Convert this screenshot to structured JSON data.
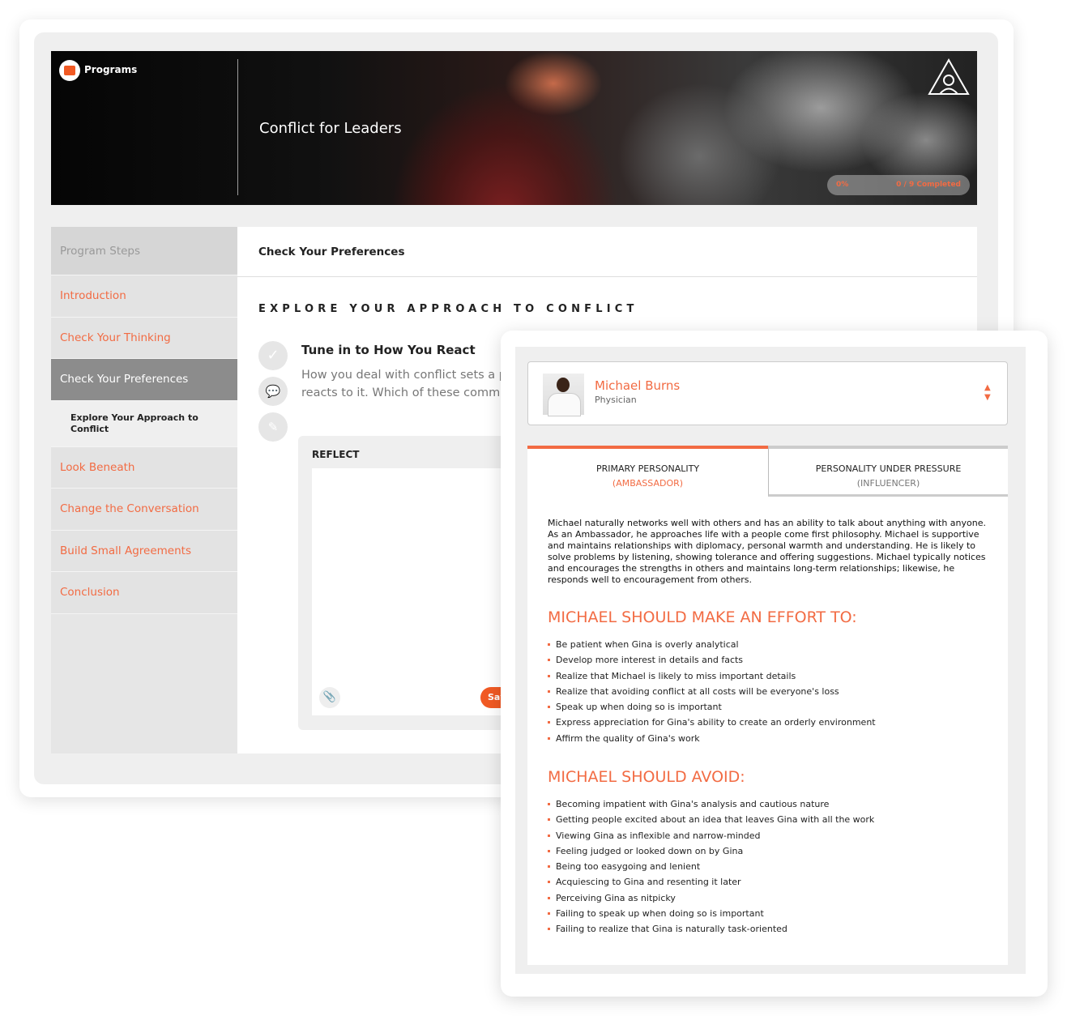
{
  "header": {
    "brand": "Programs",
    "title": "Conflict for Leaders",
    "progress_percent": "0%",
    "progress_count": "0 / 9 Completed",
    "accent": "#f26b43"
  },
  "sidebar": {
    "heading": "Program Steps",
    "items": [
      {
        "label": "Introduction"
      },
      {
        "label": "Check Your Thinking"
      },
      {
        "label": "Check Your Preferences",
        "active": true
      },
      {
        "label": "Explore Your Approach to Conflict",
        "sub": true
      },
      {
        "label": "Look Beneath"
      },
      {
        "label": "Change the Conversation"
      },
      {
        "label": "Build Small Agreements"
      },
      {
        "label": "Conclusion"
      }
    ]
  },
  "main": {
    "breadcrumb": "Check Your Preferences",
    "section_title": "EXPLORE YOUR APPROACH TO CONFLICT",
    "step_title": "Tune in to How You React",
    "desc_line1": "How you deal with conflict sets a p",
    "desc_line2": "reacts to it. Which of these commo",
    "reflect_label": "REFLECT",
    "save_label": "Save"
  },
  "profile": {
    "name": "Michael Burns",
    "role": "Physician",
    "tabs": [
      {
        "label": "PRIMARY PERSONALITY",
        "sub": "(AMBASSADOR)",
        "active": true
      },
      {
        "label": "PERSONALITY UNDER PRESSURE",
        "sub": "(INFLUENCER)"
      }
    ],
    "summary": "Michael naturally networks well with others and has an ability to talk about anything with anyone. As an Ambassador, he approaches life with a people come first philosophy. Michael is supportive and maintains relationships with diplomacy, personal warmth and understanding. He is likely to solve problems by listening, showing tolerance and offering suggestions. Michael typically notices and encourages the strengths in others and maintains long-term relationships; likewise, he responds well to encouragement from others.",
    "effort_heading": "MICHAEL SHOULD MAKE AN EFFORT TO:",
    "effort": [
      "Be patient when Gina is overly analytical",
      "Develop more interest in details and facts",
      "Realize that Michael is likely to miss important details",
      "Realize that avoiding conflict at all costs will be everyone's loss",
      "Speak up when doing so is important",
      "Express appreciation for Gina's ability to create an orderly environment",
      "Affirm the quality of Gina's work"
    ],
    "avoid_heading": "MICHAEL SHOULD AVOID:",
    "avoid": [
      "Becoming impatient with Gina's analysis and cautious nature",
      "Getting people excited about an idea that leaves Gina with all the work",
      "Viewing Gina as inflexible and narrow-minded",
      "Feeling judged or looked down on by Gina",
      "Being too easygoing and lenient",
      "Acquiescing to Gina and resenting it later",
      "Perceiving Gina as nitpicky",
      "Failing to speak up when doing so is important",
      "Failing to realize that Gina is naturally task-oriented"
    ]
  }
}
